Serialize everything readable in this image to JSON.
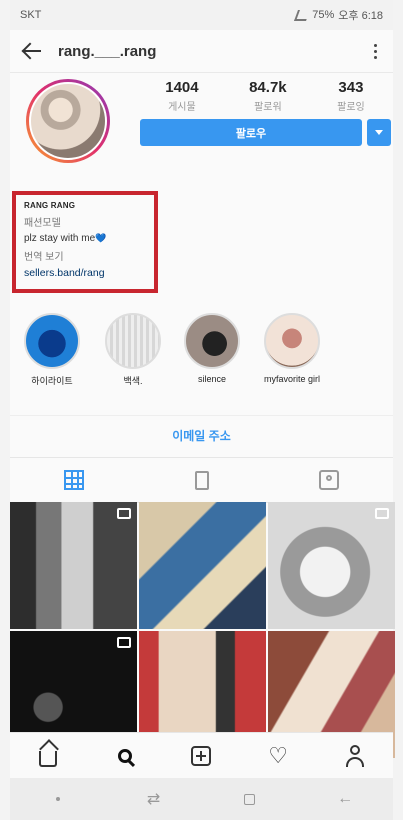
{
  "status_bar": {
    "carrier": "SKT",
    "battery": "75%",
    "time": "오후 6:18"
  },
  "header": {
    "username": "rang.___.rang"
  },
  "profile": {
    "stats": [
      {
        "value": "1404",
        "label": "게시물"
      },
      {
        "value": "84.7k",
        "label": "팔로워"
      },
      {
        "value": "343",
        "label": "팔로잉"
      }
    ],
    "follow_label": "팔로우"
  },
  "bio": {
    "name": "RANG RANG",
    "category": "패션모델",
    "text": "plz stay with me",
    "heart": "💙",
    "translate": "번역 보기",
    "link": "sellers.band/rang"
  },
  "highlights": [
    {
      "label": "하이라이트"
    },
    {
      "label": "백색."
    },
    {
      "label": "silence"
    },
    {
      "label": "myfavorite girl"
    }
  ],
  "email_button": "이메일 주소",
  "colors": {
    "accent": "#3897f0",
    "highlight_box": "#c8262f"
  }
}
